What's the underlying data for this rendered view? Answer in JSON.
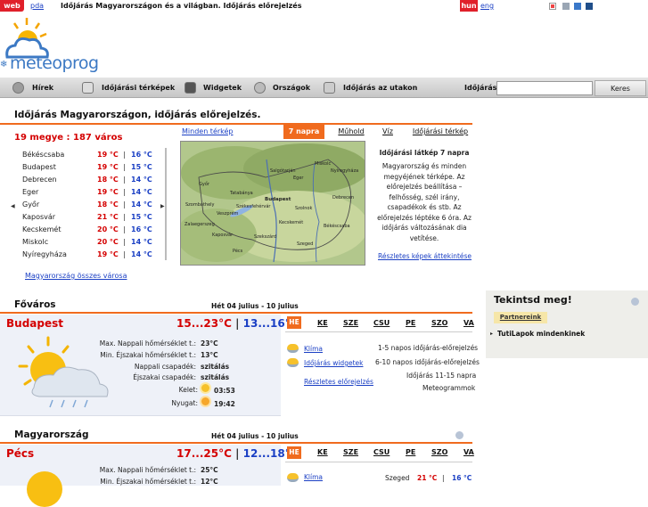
{
  "topbar": {
    "web": "web",
    "pda": "pda",
    "title": "Időjárás Magyarországon és a világban. Időjárás előrejelzés",
    "hun": "hun",
    "eng": "eng"
  },
  "logo": {
    "text": "meteoprog"
  },
  "nav": {
    "items": [
      "Hírek",
      "Időjárási térképek",
      "Widgetek",
      "Országok",
      "Időjárás az utakon"
    ],
    "search_label": "Időjárás:",
    "search_value": "",
    "search_button": "Keres"
  },
  "main": {
    "heading": "Időjárás Magyarországon, időjárás előrejelzés.",
    "count_title": "19 megye : 187 város",
    "cities": [
      {
        "name": "Békéscsaba",
        "t1": "19 °C",
        "t2": "16 °C"
      },
      {
        "name": "Budapest",
        "t1": "19 °C",
        "t2": "15 °C"
      },
      {
        "name": "Debrecen",
        "t1": "18 °C",
        "t2": "14 °C"
      },
      {
        "name": "Eger",
        "t1": "19 °C",
        "t2": "14 °C"
      },
      {
        "name": "Győr",
        "t1": "18 °C",
        "t2": "14 °C"
      },
      {
        "name": "Kaposvár",
        "t1": "21 °C",
        "t2": "15 °C"
      },
      {
        "name": "Kecskemét",
        "t1": "20 °C",
        "t2": "16 °C"
      },
      {
        "name": "Miskolc",
        "t1": "20 °C",
        "t2": "14 °C"
      },
      {
        "name": "Nyíregyháza",
        "t1": "19 °C",
        "t2": "14 °C"
      }
    ],
    "separator": "|",
    "all_cities_link": "Magyarország összes városa",
    "all_maps_link": "Minden térkép",
    "map_tabs": [
      "7 napra",
      "Műhold",
      "Víz",
      "Időjárási térkép"
    ],
    "map_desc_title": "Időjárási látkép 7 napra",
    "map_desc": "Magyarország és minden megyéjének térképe. Az előrejelzés beállítása – felhősség, szél irány, csapadékok és stb. Az előrejelzés léptéke 6 óra. Az időjárás változásának dia vetítése.",
    "map_more_link": "Részletes képek áttekintése",
    "map_places": [
      "Miskolc",
      "Salgótarján",
      "Eger",
      "Nyíregyháza",
      "Győr",
      "Tatabánya",
      "Budapest",
      "Debrecen",
      "Szombathely",
      "Székesfehérvár",
      "Szolnok",
      "Veszprém",
      "Zalaegerszeg",
      "Kecskemét",
      "Békéscsaba",
      "Kaposvár",
      "Szekszárd",
      "Szeged",
      "Pécs"
    ]
  },
  "sidebar": {
    "title": "Tekintsd meg!",
    "partners_tab": "Partnereink",
    "item": "TutiLapok mindenkinek"
  },
  "capital": {
    "section": "Főváros",
    "week": "Hét 04 julius - 10 julius",
    "city": "Budapest",
    "temp_day": "15...23°C",
    "sep": "|",
    "temp_night": "13...16°C",
    "rows": [
      {
        "label": "Max. Nappali hőmérséklet t.:",
        "value": "23°C"
      },
      {
        "label": "Min. Éjszakai hőmérséklet t.:",
        "value": "13°C"
      },
      {
        "label": "Nappali csapadék:",
        "value": "szitálás"
      },
      {
        "label": "Éjszakai csapadék:",
        "value": "szitálás"
      }
    ],
    "sunrise_label": "Kelet:",
    "sunrise": "03:53",
    "sunset_label": "Nyugat:",
    "sunset": "19:42",
    "days": [
      "HE",
      "KE",
      "SZE",
      "CSU",
      "PE",
      "SZO",
      "VA"
    ],
    "links": [
      "Klíma",
      "Időjárás widgetek",
      "Részletes előrejelzés"
    ],
    "info": [
      "1-5 napos időjárás-előrejelzés",
      "6-10 napos időjárás-előrejelzés",
      "Időjárás 11-15 napra",
      "Meteogrammok"
    ]
  },
  "country": {
    "section": "Magyarország",
    "week": "Hét 04 julius - 10 julius",
    "city": "Pécs",
    "temp_day": "17...25°C",
    "sep": "|",
    "temp_night": "12...18°C",
    "rows": [
      {
        "label": "Max. Nappali hőmérséklet t.:",
        "value": "25°C"
      },
      {
        "label": "Min. Éjszakai hőmérséklet t.:",
        "value": "12°C"
      }
    ],
    "days": [
      "HE",
      "KE",
      "SZE",
      "CSU",
      "PE",
      "SZO",
      "VA"
    ],
    "link": "Klíma",
    "other_city": "Szeged",
    "other_t1": "21 °C",
    "other_sep": "|",
    "other_t2": "16 °C"
  },
  "colors": {
    "orange": "#f06b1e",
    "red": "#d40000",
    "blue": "#1a3fc4",
    "header_bg": "#eef1f8"
  }
}
